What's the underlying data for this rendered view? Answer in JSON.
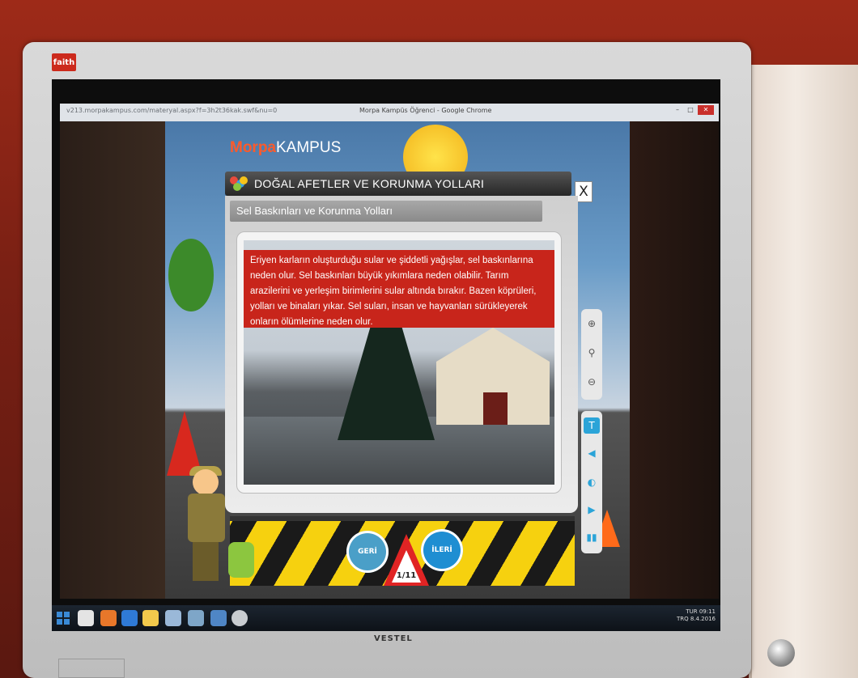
{
  "device": {
    "brand_badge": "faith",
    "monitor_brand": "VESTEL"
  },
  "browser": {
    "url": "v213.morpakampus.com/materyal.aspx?f=3h2t36kak.swf&nu=0",
    "window_title": "Morpa Kampüs Öğrenci - Google Chrome",
    "controls": {
      "minimize": "–",
      "maximize": "□",
      "close": "✕"
    }
  },
  "app": {
    "logo": {
      "prefix": "Morpa",
      "suffix": "KAMPUS"
    },
    "modal": {
      "title": "DOĞAL AFETLER VE KORUNMA YOLLARI",
      "close_label": "X",
      "subtitle": "Sel Baskınları ve Korunma Yolları",
      "description": "Eriyen karların oluşturduğu sular ve şiddetli yağışlar, sel baskınlarına neden olur. Sel baskınları büyük yıkımlara neden olabilir. Tarım arazilerini ve yerleşim birimlerini sular altında bırakır. Bazen köprüleri, yolları ve binaları yıkar. Sel suları, insan ve hayvanları sürükleyerek onların ölümlerine neden olur."
    },
    "tools": {
      "zoom_in": "⊕",
      "zoom_reset": "⚲",
      "zoom_out": "⊖",
      "text_toggle": "T",
      "audio": "◀",
      "globe": "◐",
      "play": "▶",
      "book": "▮▮"
    },
    "navigation": {
      "back_label": "GERİ",
      "next_label": "İLERİ",
      "page_indicator": "1/11"
    }
  },
  "taskbar": {
    "clock_time": "09:11",
    "clock_date": "8.4.2016",
    "language": "TUR",
    "region": "TRQ"
  },
  "colors": {
    "header_red": "#c8251b",
    "nav_blue": "#1e8ed2",
    "warning_yellow": "#f6d10f"
  }
}
